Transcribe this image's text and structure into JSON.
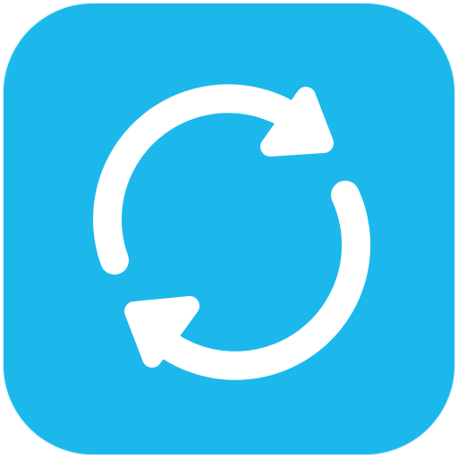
{
  "app_icon": {
    "icon": "sync-refresh-icon",
    "background_color": "#1CB8EC",
    "glyph_color": "#FFFFFF"
  }
}
